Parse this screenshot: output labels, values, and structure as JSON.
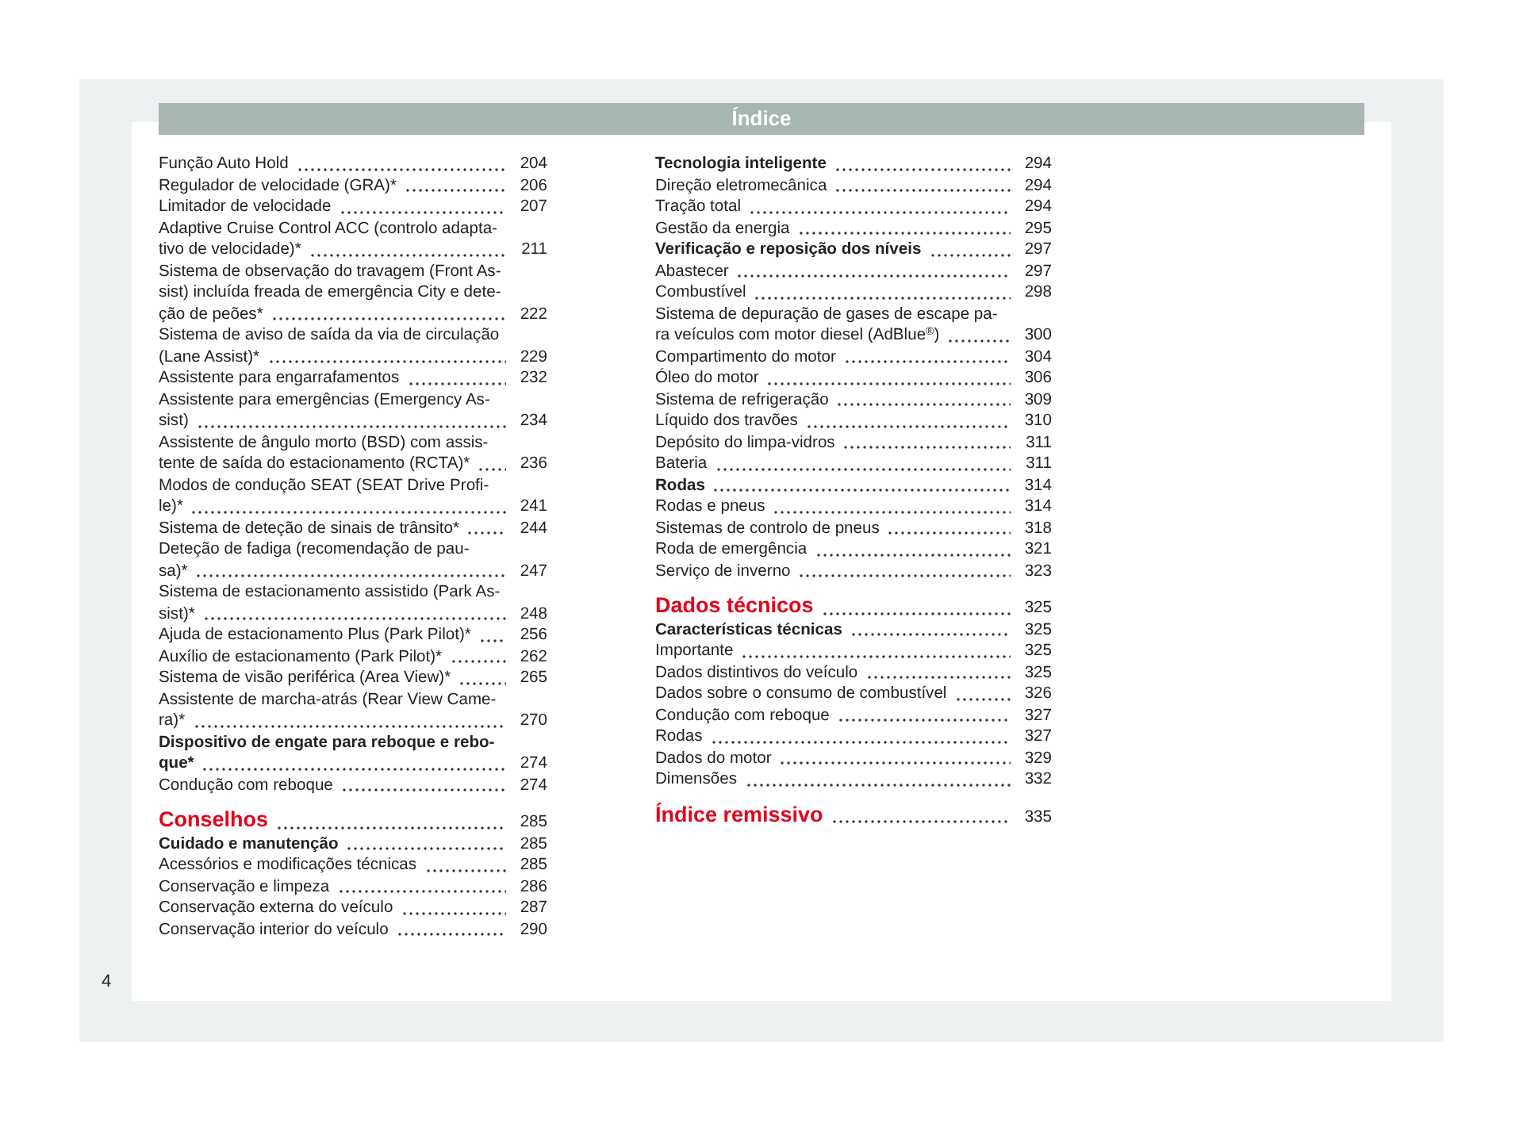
{
  "header": {
    "title": "Índice"
  },
  "columns": [
    {
      "entries": [
        {
          "kind": "normal",
          "lines": [
            "Função Auto Hold"
          ],
          "page": "204"
        },
        {
          "kind": "normal",
          "lines": [
            "Regulador de velocidade (GRA)*"
          ],
          "page": "206"
        },
        {
          "kind": "normal",
          "lines": [
            "Limitador de velocidade"
          ],
          "page": "207"
        },
        {
          "kind": "normal",
          "lines": [
            "Adaptive Cruise Control ACC (controlo adapta-",
            "tivo de velocidade)*"
          ],
          "page": "211"
        },
        {
          "kind": "normal",
          "lines": [
            "Sistema de observação do travagem (Front As-",
            "sist) incluída freada de emergência City e dete-",
            "ção de peões*"
          ],
          "page": "222"
        },
        {
          "kind": "normal",
          "lines": [
            "Sistema de aviso de saída da via de circulação",
            "(Lane Assist)*"
          ],
          "page": "229"
        },
        {
          "kind": "normal",
          "lines": [
            "Assistente para engarrafamentos"
          ],
          "page": "232"
        },
        {
          "kind": "normal",
          "lines": [
            "Assistente para emergências (Emergency As-",
            "sist)"
          ],
          "page": "234"
        },
        {
          "kind": "normal",
          "lines": [
            "Assistente de ângulo morto (BSD) com assis-",
            "tente de saída do estacionamento (RCTA)*"
          ],
          "page": "236"
        },
        {
          "kind": "normal",
          "lines": [
            "Modos de condução SEAT (SEAT Drive Profi-",
            "le)*"
          ],
          "page": "241"
        },
        {
          "kind": "normal",
          "lines": [
            "Sistema de deteção de sinais de trânsito*"
          ],
          "page": "244"
        },
        {
          "kind": "normal",
          "lines": [
            "Deteção de fadiga (recomendação de pau-",
            "sa)*"
          ],
          "page": "247"
        },
        {
          "kind": "normal",
          "lines": [
            "Sistema de estacionamento assistido (Park As-",
            "sist)*"
          ],
          "page": "248"
        },
        {
          "kind": "normal",
          "lines": [
            "Ajuda de estacionamento Plus (Park Pilot)*"
          ],
          "page": "256"
        },
        {
          "kind": "normal",
          "lines": [
            "Auxílio de estacionamento (Park Pilot)*"
          ],
          "page": "262"
        },
        {
          "kind": "normal",
          "lines": [
            "Sistema de visão periférica (Area View)*"
          ],
          "page": "265"
        },
        {
          "kind": "normal",
          "lines": [
            "Assistente de marcha-atrás (Rear View Came-",
            "ra)*"
          ],
          "page": "270"
        },
        {
          "kind": "bold",
          "lines": [
            "Dispositivo de engate para reboque e rebo-",
            "que*"
          ],
          "page": "274"
        },
        {
          "kind": "normal",
          "lines": [
            "Condução com reboque"
          ],
          "page": "274"
        },
        {
          "kind": "section",
          "lines": [
            "Conselhos"
          ],
          "page": "285"
        },
        {
          "kind": "bold",
          "lines": [
            "Cuidado e manutenção"
          ],
          "page": "285"
        },
        {
          "kind": "normal",
          "lines": [
            "Acessórios e modificações técnicas"
          ],
          "page": "285"
        },
        {
          "kind": "normal",
          "lines": [
            "Conservação e limpeza"
          ],
          "page": "286"
        },
        {
          "kind": "normal",
          "lines": [
            "Conservação externa do veículo"
          ],
          "page": "287"
        },
        {
          "kind": "normal",
          "lines": [
            "Conservação interior do veículo"
          ],
          "page": "290"
        }
      ]
    },
    {
      "entries": [
        {
          "kind": "bold",
          "lines": [
            "Tecnologia inteligente"
          ],
          "page": "294"
        },
        {
          "kind": "normal",
          "lines": [
            "Direção eletromecânica"
          ],
          "page": "294"
        },
        {
          "kind": "normal",
          "lines": [
            "Tração total"
          ],
          "page": "294"
        },
        {
          "kind": "normal",
          "lines": [
            "Gestão da energia"
          ],
          "page": "295"
        },
        {
          "kind": "bold",
          "lines": [
            "Verificação e reposição dos níveis"
          ],
          "page": "297"
        },
        {
          "kind": "normal",
          "lines": [
            "Abastecer"
          ],
          "page": "297"
        },
        {
          "kind": "normal",
          "lines": [
            "Combustível"
          ],
          "page": "298"
        },
        {
          "kind": "normal",
          "lines": [
            "Sistema de depuração de gases de escape pa-",
            "ra veículos com motor diesel (AdBlue$^{®}$)"
          ],
          "page": "300"
        },
        {
          "kind": "normal",
          "lines": [
            "Compartimento do motor"
          ],
          "page": "304"
        },
        {
          "kind": "normal",
          "lines": [
            "Óleo do motor"
          ],
          "page": "306"
        },
        {
          "kind": "normal",
          "lines": [
            "Sistema de refrigeração"
          ],
          "page": "309"
        },
        {
          "kind": "normal",
          "lines": [
            "Líquido dos travões"
          ],
          "page": "310"
        },
        {
          "kind": "normal",
          "lines": [
            "Depósito do limpa-vidros"
          ],
          "page": "311"
        },
        {
          "kind": "normal",
          "lines": [
            "Bateria"
          ],
          "page": "311"
        },
        {
          "kind": "bold",
          "lines": [
            "Rodas"
          ],
          "page": "314"
        },
        {
          "kind": "normal",
          "lines": [
            "Rodas e pneus"
          ],
          "page": "314"
        },
        {
          "kind": "normal",
          "lines": [
            "Sistemas de controlo de pneus"
          ],
          "page": "318"
        },
        {
          "kind": "normal",
          "lines": [
            "Roda de emergência"
          ],
          "page": "321"
        },
        {
          "kind": "normal",
          "lines": [
            "Serviço de inverno"
          ],
          "page": "323"
        },
        {
          "kind": "section",
          "lines": [
            "Dados técnicos"
          ],
          "page": "325"
        },
        {
          "kind": "bold",
          "lines": [
            "Características técnicas"
          ],
          "page": "325"
        },
        {
          "kind": "normal",
          "lines": [
            "Importante"
          ],
          "page": "325"
        },
        {
          "kind": "normal",
          "lines": [
            "Dados distintivos do veículo"
          ],
          "page": "325"
        },
        {
          "kind": "normal",
          "lines": [
            "Dados sobre o consumo de combustível"
          ],
          "page": "326"
        },
        {
          "kind": "normal",
          "lines": [
            "Condução com reboque"
          ],
          "page": "327"
        },
        {
          "kind": "normal",
          "lines": [
            "Rodas"
          ],
          "page": "327"
        },
        {
          "kind": "normal",
          "lines": [
            "Dados do motor"
          ],
          "page": "329"
        },
        {
          "kind": "normal",
          "lines": [
            "Dimensões"
          ],
          "page": "332"
        },
        {
          "kind": "section",
          "lines": [
            "Índice remissivo"
          ],
          "page": "335"
        }
      ]
    }
  ],
  "page_number": "4"
}
